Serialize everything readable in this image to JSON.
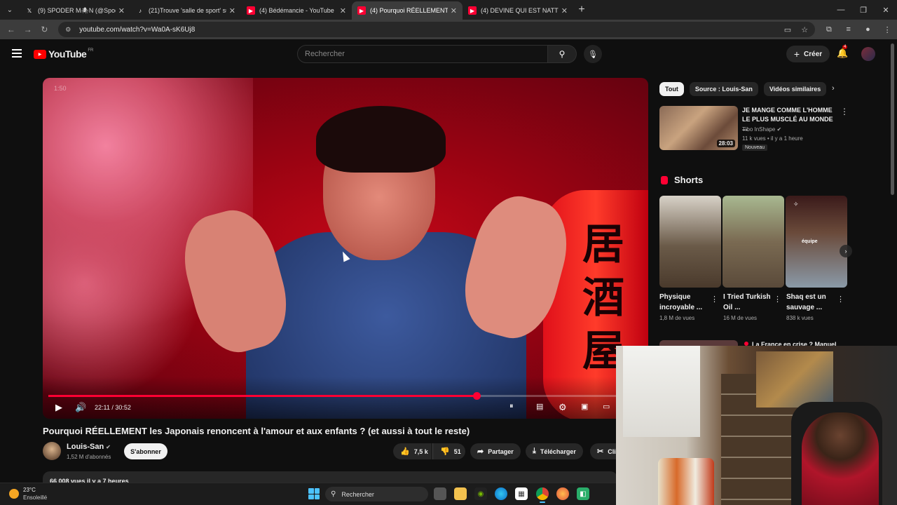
{
  "browser": {
    "tabs": [
      {
        "title": "(9) SPODER M🕷N (@Spoder_",
        "icon": "x-icon",
        "active": false
      },
      {
        "title": "(21)Trouve 'salle de sport' sur T",
        "icon": "tiktok-icon",
        "active": false
      },
      {
        "title": "(4) Bédémancie - YouTube",
        "icon": "youtube-icon",
        "active": false
      },
      {
        "title": "(4) Pourquoi RÉELLEMENT les Ja",
        "icon": "youtube-icon",
        "active": true
      },
      {
        "title": "(4) DEVINE QUI EST NATTY ? #s",
        "icon": "youtube-icon",
        "active": false
      }
    ],
    "url": "youtube.com/watch?v=Wa0A-sK6Uj8"
  },
  "header": {
    "logo_text": "YouTube",
    "country_code": "FR",
    "search_placeholder": "Rechercher",
    "create_label": "Créer",
    "notification_count": "4"
  },
  "player": {
    "overlay_timestamp": "1:50",
    "lantern_text": "居酒屋",
    "current_time": "22:11 / 30:52",
    "progress": 0.72
  },
  "video": {
    "title": "Pourquoi RÉELLEMENT les Japonais renoncent à l'amour et aux enfants ? (et aussi à tout le reste)",
    "channel": "Louis-San",
    "subscribers": "1,52 M d'abonnés",
    "subscribe_label": "S'abonner",
    "likes": "7,5 k",
    "dislikes": "51",
    "share_label": "Partager",
    "download_label": "Télécharger",
    "clip_label": "Cli",
    "description_stats": "66 008 vues  il y a 7 heures"
  },
  "sidebar": {
    "chips": [
      {
        "label": "Tout",
        "active": true
      },
      {
        "label": "Source : Louis-San",
        "active": false
      },
      {
        "label": "Vidéos similaires",
        "active": false
      }
    ],
    "recommended": {
      "title": "JE MANGE COMME L'HOMME LE PLUS MUSCLÉ AU MONDE ...",
      "channel": "Tibo InShape",
      "meta": "11 k vues • il y a 1 heure",
      "badge": "Nouveau",
      "duration": "28:03"
    },
    "shorts_heading": "Shorts",
    "shorts": [
      {
        "title": "Physique incroyable ...",
        "views": "1,8 M de vues"
      },
      {
        "title": "I Tried Turkish Oil ...",
        "views": "16 M de vues"
      },
      {
        "title": "Shaq est un sauvage ...",
        "views": "838 k vues",
        "overlay": "équipe"
      }
    ],
    "next_title": "La France en crise ? Manuel"
  },
  "taskbar": {
    "temperature": "23°C",
    "condition": "Ensoleillé",
    "search_label": "Rechercher"
  }
}
